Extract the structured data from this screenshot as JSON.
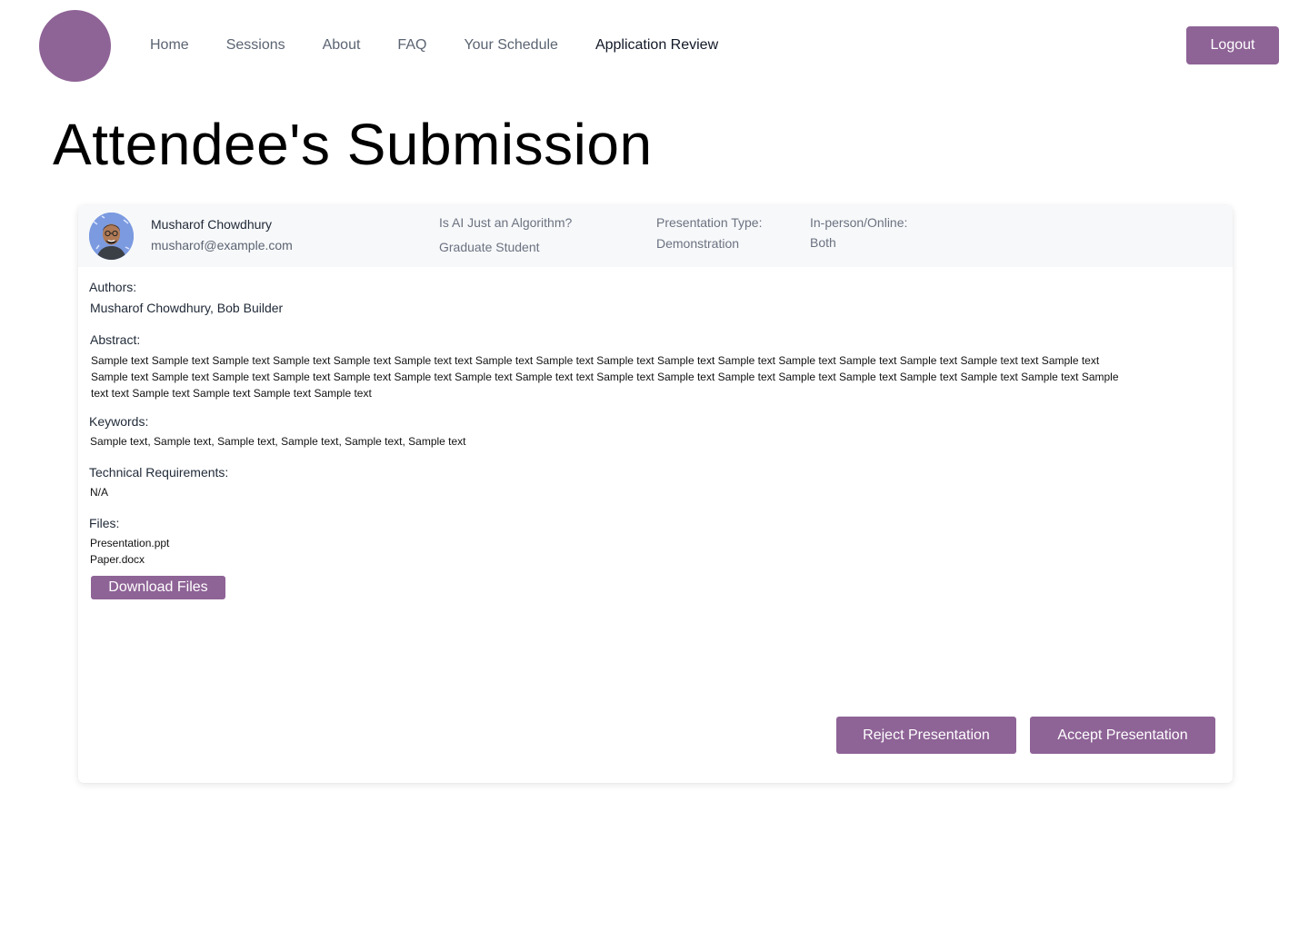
{
  "brand": {
    "accent_color": "#8e6396"
  },
  "nav": {
    "items": [
      {
        "label": "Home"
      },
      {
        "label": "Sessions"
      },
      {
        "label": "About"
      },
      {
        "label": "FAQ"
      },
      {
        "label": "Your Schedule"
      },
      {
        "label": "Application Review"
      }
    ],
    "active": "Application Review",
    "logout_label": "Logout"
  },
  "page": {
    "title": "Attendee's Submission"
  },
  "submission": {
    "attendee_name": "Musharof Chowdhury",
    "attendee_email": "musharof@example.com",
    "presentation_title": "Is AI Just an Algorithm?",
    "attendee_role": "Graduate Student",
    "presentation_type_label": "Presentation Type:",
    "presentation_type_value": "Demonstration",
    "mode_label": "In-person/Online:",
    "mode_value": "Both",
    "authors_label": "Authors:",
    "authors_value": "Musharof Chowdhury, Bob Builder",
    "abstract_label": "Abstract:",
    "abstract_value": "Sample text Sample text Sample text Sample text Sample text Sample text  text Sample text Sample text Sample text  Sample text Sample text Sample text Sample text Sample text Sample text  text Sample text Sample text Sample text  Sample text Sample text Sample text Sample text Sample text Sample text  text Sample text Sample text Sample text  Sample text Sample text Sample text Sample text Sample text Sample text  text Sample text Sample text Sample text  Sample text",
    "keywords_label": "Keywords:",
    "keywords_value": "Sample text, Sample text, Sample text, Sample text, Sample text, Sample text",
    "tech_label": "Technical Requirements:",
    "tech_value": "N/A",
    "files_label": "Files:",
    "files": [
      "Presentation.ppt",
      "Paper.docx"
    ],
    "download_label": "Download Files"
  },
  "actions": {
    "reject_label": "Reject Presentation",
    "accept_label": "Accept Presentation"
  }
}
